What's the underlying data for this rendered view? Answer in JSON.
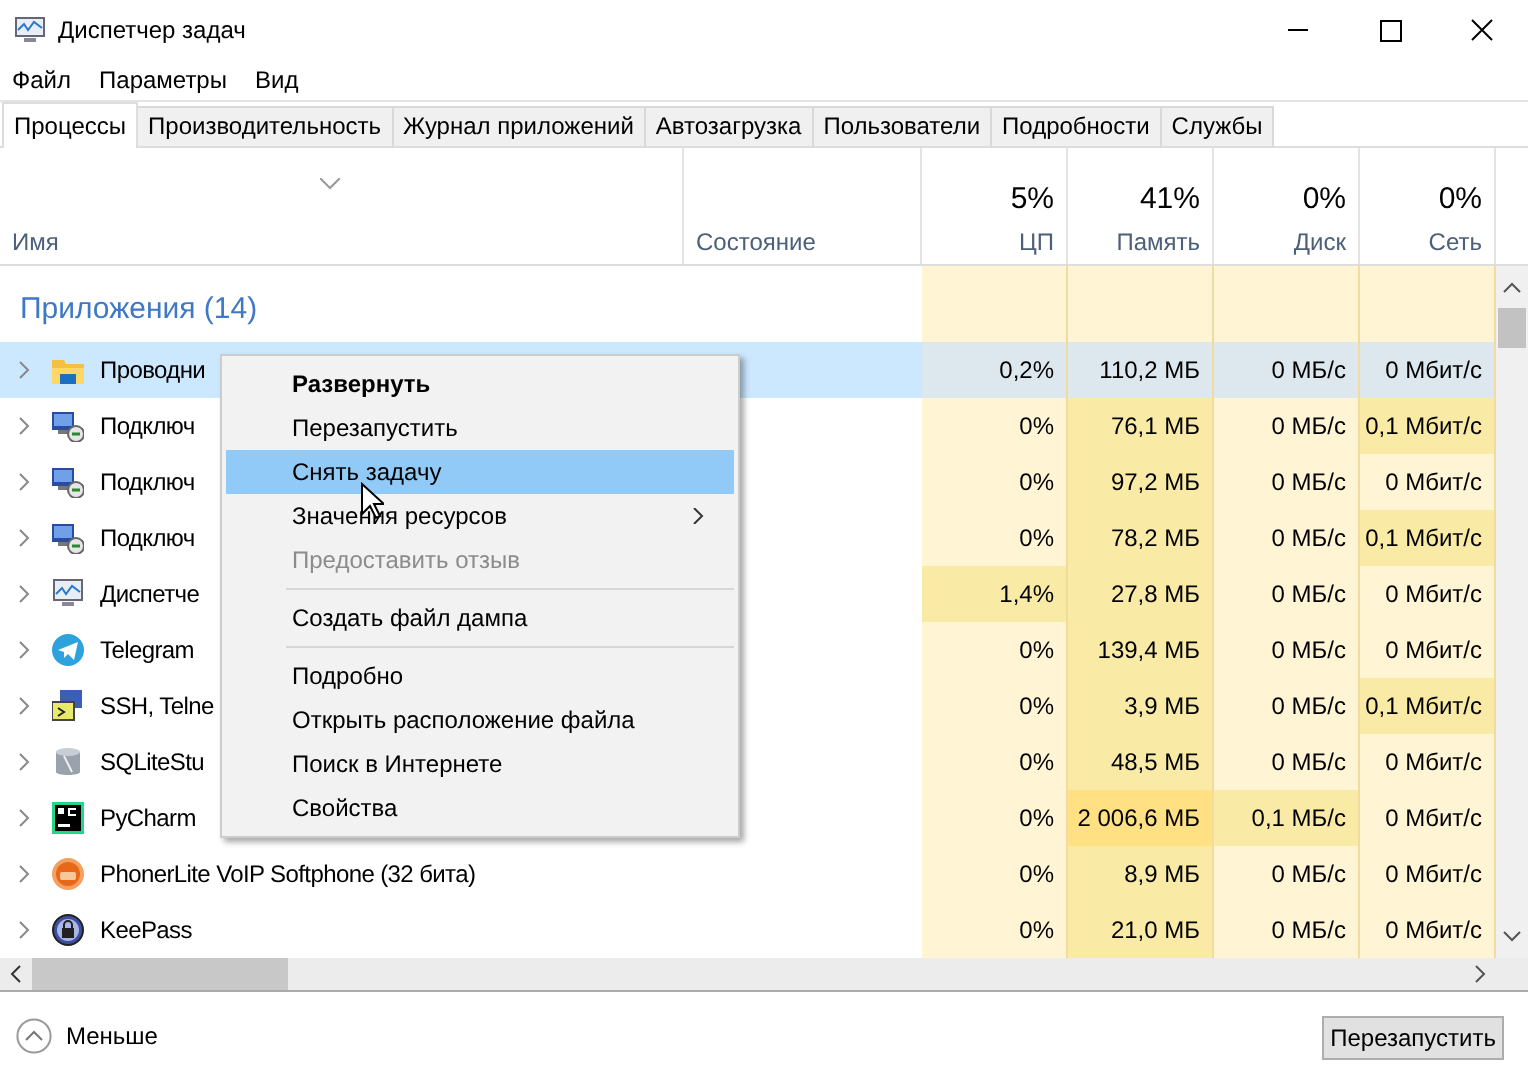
{
  "window": {
    "title": "Диспетчер задач"
  },
  "menu": [
    "Файл",
    "Параметры",
    "Вид"
  ],
  "tabs": [
    {
      "label": "Процессы",
      "selected": true
    },
    {
      "label": "Производительность",
      "selected": false
    },
    {
      "label": "Журнал приложений",
      "selected": false
    },
    {
      "label": "Автозагрузка",
      "selected": false
    },
    {
      "label": "Пользователи",
      "selected": false
    },
    {
      "label": "Подробности",
      "selected": false
    },
    {
      "label": "Службы",
      "selected": false
    }
  ],
  "columns": [
    {
      "label": "Имя"
    },
    {
      "label": "Состояние"
    },
    {
      "label": "ЦП",
      "reading": "5%"
    },
    {
      "label": "Память",
      "reading": "41%"
    },
    {
      "label": "Диск",
      "reading": "0%"
    },
    {
      "label": "Сеть",
      "reading": "0%"
    }
  ],
  "group": {
    "label": "Приложения (14)"
  },
  "rows": [
    {
      "kind": "folder",
      "name": "Проводни",
      "selected": true,
      "cells": [
        {
          "text": "0,2%",
          "color": "#dce8ee"
        },
        {
          "text": "110,2 МБ",
          "color": "#dce8ee"
        },
        {
          "text": "0 МБ/с",
          "color": "#dce8ee"
        },
        {
          "text": "0 Мбит/с",
          "color": "#dce8ee"
        }
      ]
    },
    {
      "kind": "remote",
      "name": "Подключ",
      "selected": false,
      "cells": [
        {
          "text": "0%",
          "color": "#fff4d4"
        },
        {
          "text": "76,1 МБ",
          "color": "#f9eba6"
        },
        {
          "text": "0 МБ/с",
          "color": "#fff4d4"
        },
        {
          "text": "0,1 Мбит/с",
          "color": "#f9eba6"
        }
      ]
    },
    {
      "kind": "remote",
      "name": "Подключ",
      "selected": false,
      "cells": [
        {
          "text": "0%",
          "color": "#fff4d4"
        },
        {
          "text": "97,2 МБ",
          "color": "#f9eba6"
        },
        {
          "text": "0 МБ/с",
          "color": "#fff4d4"
        },
        {
          "text": "0 Мбит/с",
          "color": "#fff4d4"
        }
      ]
    },
    {
      "kind": "remote",
      "name": "Подключ",
      "selected": false,
      "cells": [
        {
          "text": "0%",
          "color": "#fff4d4"
        },
        {
          "text": "78,2 МБ",
          "color": "#f9eba6"
        },
        {
          "text": "0 МБ/с",
          "color": "#fff4d4"
        },
        {
          "text": "0,1 Мбит/с",
          "color": "#f9eba6"
        }
      ]
    },
    {
      "kind": "monitor",
      "name": "Диспетче",
      "selected": false,
      "cells": [
        {
          "text": "1,4%",
          "color": "#f9eba6"
        },
        {
          "text": "27,8 МБ",
          "color": "#f9eba6"
        },
        {
          "text": "0 МБ/с",
          "color": "#fff4d4"
        },
        {
          "text": "0 Мбит/с",
          "color": "#fff4d4"
        }
      ]
    },
    {
      "kind": "plane",
      "name": "Telegram",
      "selected": false,
      "cells": [
        {
          "text": "0%",
          "color": "#fff4d4"
        },
        {
          "text": "139,4 МБ",
          "color": "#f9eba6"
        },
        {
          "text": "0 МБ/с",
          "color": "#fff4d4"
        },
        {
          "text": "0 Мбит/с",
          "color": "#fff4d4"
        }
      ]
    },
    {
      "kind": "terminal",
      "name": "SSH, Telne",
      "selected": false,
      "cells": [
        {
          "text": "0%",
          "color": "#fff4d4"
        },
        {
          "text": "3,9 МБ",
          "color": "#f9eba6"
        },
        {
          "text": "0 МБ/с",
          "color": "#fff4d4"
        },
        {
          "text": "0,1 Мбит/с",
          "color": "#f9eba6"
        }
      ]
    },
    {
      "kind": "database",
      "name": "SQLiteStu",
      "selected": false,
      "cells": [
        {
          "text": "0%",
          "color": "#fff4d4"
        },
        {
          "text": "48,5 МБ",
          "color": "#f9eba6"
        },
        {
          "text": "0 МБ/с",
          "color": "#fff4d4"
        },
        {
          "text": "0 Мбит/с",
          "color": "#fff4d4"
        }
      ]
    },
    {
      "kind": "pc",
      "name": "PyCharm",
      "selected": false,
      "cells": [
        {
          "text": "0%",
          "color": "#fff4d4"
        },
        {
          "text": "2 006,6 МБ",
          "color": "#ffe083"
        },
        {
          "text": "0,1 МБ/с",
          "color": "#f9eba6"
        },
        {
          "text": "0 Мбит/с",
          "color": "#fff4d4"
        }
      ]
    },
    {
      "kind": "phone",
      "name": "PhonerLite VoIP Softphone (32 бита)",
      "selected": false,
      "cells": [
        {
          "text": "0%",
          "color": "#fff4d4"
        },
        {
          "text": "8,9 МБ",
          "color": "#f9eba6"
        },
        {
          "text": "0 МБ/с",
          "color": "#fff4d4"
        },
        {
          "text": "0 Мбит/с",
          "color": "#fff4d4"
        }
      ]
    },
    {
      "kind": "lock",
      "name": "KeePass",
      "selected": false,
      "cells": [
        {
          "text": "0%",
          "color": "#fff4d4"
        },
        {
          "text": "21,0 МБ",
          "color": "#f9eba6"
        },
        {
          "text": "0 МБ/с",
          "color": "#fff4d4"
        },
        {
          "text": "0 Мбит/с",
          "color": "#fff4d4"
        }
      ]
    }
  ],
  "context_menu": [
    {
      "kind": "item",
      "label": "Развернуть",
      "default": true,
      "selected": false,
      "disabled": false,
      "submenu": false
    },
    {
      "kind": "item",
      "label": "Перезапустить",
      "default": false,
      "selected": false,
      "disabled": false,
      "submenu": false
    },
    {
      "kind": "item",
      "label": "Снять задачу",
      "default": false,
      "selected": true,
      "disabled": false,
      "submenu": false
    },
    {
      "kind": "item",
      "label": "Значения ресурсов",
      "default": false,
      "selected": false,
      "disabled": false,
      "submenu": true
    },
    {
      "kind": "item",
      "label": "Предоставить отзыв",
      "default": false,
      "selected": false,
      "disabled": true,
      "submenu": false
    },
    {
      "kind": "separator"
    },
    {
      "kind": "item",
      "label": "Создать файл дампа",
      "default": false,
      "selected": false,
      "disabled": false,
      "submenu": false
    },
    {
      "kind": "separator"
    },
    {
      "kind": "item",
      "label": "Подробно",
      "default": false,
      "selected": false,
      "disabled": false,
      "submenu": false
    },
    {
      "kind": "item",
      "label": "Открыть расположение файла",
      "default": false,
      "selected": false,
      "disabled": false,
      "submenu": false
    },
    {
      "kind": "item",
      "label": "Поиск в Интернете",
      "default": false,
      "selected": false,
      "disabled": false,
      "submenu": false
    },
    {
      "kind": "item",
      "label": "Свойства",
      "default": false,
      "selected": false,
      "disabled": false,
      "submenu": false
    }
  ],
  "footer": {
    "toggle": "Меньше",
    "button": "Перезапустить"
  }
}
